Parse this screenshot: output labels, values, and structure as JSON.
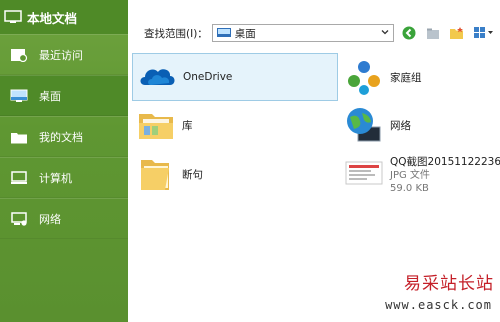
{
  "sidebar": {
    "title": "本地文档",
    "items": [
      {
        "label": "最近访问",
        "icon": "recent-icon"
      },
      {
        "label": "桌面",
        "icon": "desktop-icon",
        "active": true
      },
      {
        "label": "我的文档",
        "icon": "documents-icon"
      },
      {
        "label": "计算机",
        "icon": "computer-icon"
      },
      {
        "label": "网络",
        "icon": "network-icon"
      }
    ]
  },
  "toolbar": {
    "search_scope_label": "查找范围(I)：",
    "location_value": "桌面"
  },
  "files": [
    {
      "name": "OneDrive",
      "icon": "onedrive-icon"
    },
    {
      "name": "家庭组",
      "icon": "homegroup-icon"
    },
    {
      "name": "库",
      "icon": "library-icon"
    },
    {
      "name": "网络",
      "icon": "network-globe-icon"
    },
    {
      "name": "断句",
      "icon": "folder-icon"
    },
    {
      "name": "QQ截图20151122236",
      "type": "JPG 文件",
      "size": "59.0 KB",
      "icon": "image-file-icon"
    }
  ],
  "watermark": {
    "brand": "易采站长站",
    "url": "www.easck.com"
  },
  "colors": {
    "sidebar": "#5f9732",
    "sidebar_active": "#4f8a28",
    "selection": "#e5f3fb",
    "watermark": "#c41f28"
  }
}
